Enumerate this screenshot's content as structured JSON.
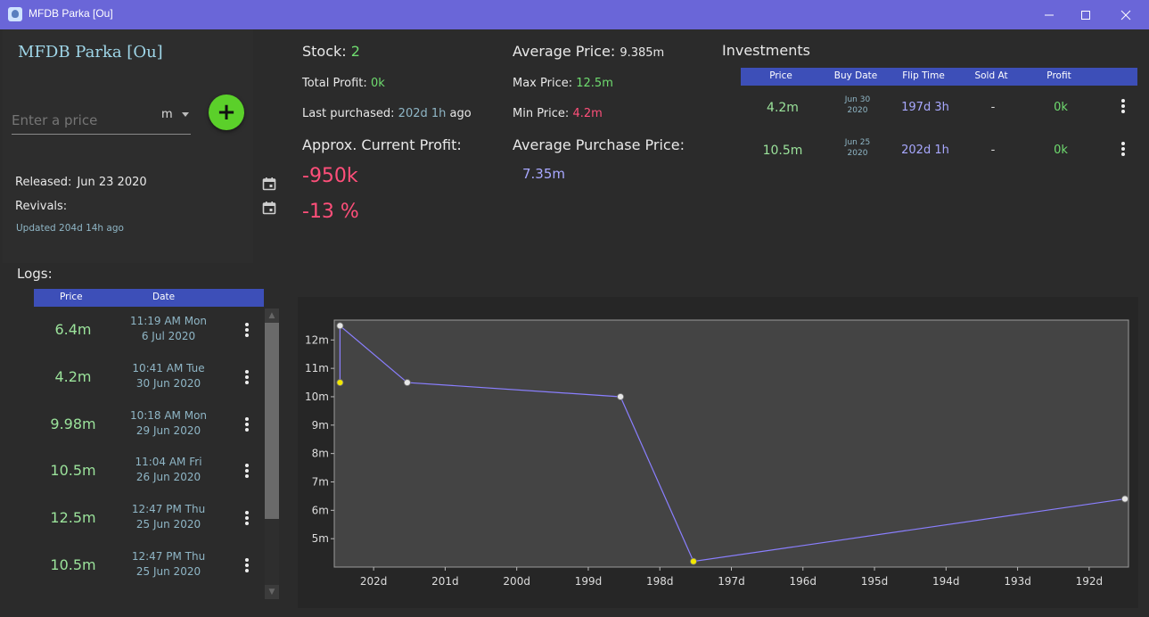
{
  "window": {
    "title": "MFDB Parka [Ou]"
  },
  "item": {
    "title": "MFDB Parka [Ou]",
    "price_placeholder": "Enter a price",
    "unit": "m",
    "released_label": "Released:",
    "released_value": "Jun 23 2020",
    "revivals_label": "Revivals:",
    "updated": "Updated 204d 14h ago"
  },
  "stats": {
    "stock_label": "Stock:",
    "stock_value": "2",
    "total_profit_label": "Total Profit:",
    "total_profit_value": "0k",
    "last_purchased_label": "Last purchased:",
    "last_purchased_value": "202d 1h",
    "last_purchased_suffix": "ago",
    "approx_profit_label": "Approx. Current Profit:",
    "approx_profit_value": "-950k",
    "approx_profit_percent": "-13 %",
    "avg_price_label": "Average Price:",
    "avg_price_value": "9.385m",
    "max_price_label": "Max Price:",
    "max_price_value": "12.5m",
    "min_price_label": "Min Price:",
    "min_price_value": "4.2m",
    "avg_purchase_label": "Average Purchase Price:",
    "avg_purchase_value": "7.35m"
  },
  "logs": {
    "title": "Logs:",
    "columns": [
      "Price",
      "Date"
    ],
    "rows": [
      {
        "price": "6.4m",
        "time": "11:19 AM Mon",
        "date": "6 Jul 2020"
      },
      {
        "price": "4.2m",
        "time": "10:41 AM Tue",
        "date": "30 Jun 2020"
      },
      {
        "price": "9.98m",
        "time": "10:18 AM Mon",
        "date": "29 Jun 2020"
      },
      {
        "price": "10.5m",
        "time": "11:04 AM Fri",
        "date": "26 Jun 2020"
      },
      {
        "price": "12.5m",
        "time": "12:47 PM Thu",
        "date": "25 Jun 2020"
      },
      {
        "price": "10.5m",
        "time": "12:47 PM Thu",
        "date": "25 Jun 2020"
      }
    ]
  },
  "investments": {
    "title": "Investments",
    "columns": [
      "Price",
      "Buy Date",
      "Flip Time",
      "Sold At",
      "Profit"
    ],
    "rows": [
      {
        "price": "4.2m",
        "buy_month_day": "Jun 30",
        "buy_year": "2020",
        "flip_time": "197d 3h",
        "sold_at": "-",
        "profit": "0k"
      },
      {
        "price": "10.5m",
        "buy_month_day": "Jun 25",
        "buy_year": "2020",
        "flip_time": "202d 1h",
        "sold_at": "-",
        "profit": "0k"
      }
    ]
  },
  "colors": {
    "accent": "#6a66d8",
    "header": "#3d4fb8",
    "add_button": "#5bd02a",
    "positive": "#6fdc6f",
    "negative": "#ff4f7a",
    "line": "#8a7fff"
  },
  "chart_data": {
    "type": "line",
    "x_unit": "days ago",
    "y_unit": "m",
    "x_ticks": [
      "202d",
      "201d",
      "200d",
      "199d",
      "198d",
      "197d",
      "196d",
      "195d",
      "194d",
      "193d",
      "192d"
    ],
    "x_tick_values": [
      202,
      201,
      200,
      199,
      198,
      197,
      196,
      195,
      194,
      193,
      192
    ],
    "y_ticks": [
      "5m",
      "6m",
      "7m",
      "8m",
      "9m",
      "10m",
      "11m",
      "12m"
    ],
    "y_tick_values": [
      5,
      6,
      7,
      8,
      9,
      10,
      11,
      12
    ],
    "xlim": [
      202.55,
      191.45
    ],
    "ylim": [
      4.0,
      12.7
    ],
    "grid": false,
    "points": [
      {
        "x": 202.47,
        "y": 10.5,
        "highlight": true
      },
      {
        "x": 202.47,
        "y": 12.5,
        "highlight": false
      },
      {
        "x": 201.53,
        "y": 10.5,
        "highlight": false
      },
      {
        "x": 198.55,
        "y": 10.0,
        "highlight": false
      },
      {
        "x": 197.53,
        "y": 4.2,
        "highlight": true
      },
      {
        "x": 191.5,
        "y": 6.4,
        "highlight": false
      }
    ]
  }
}
